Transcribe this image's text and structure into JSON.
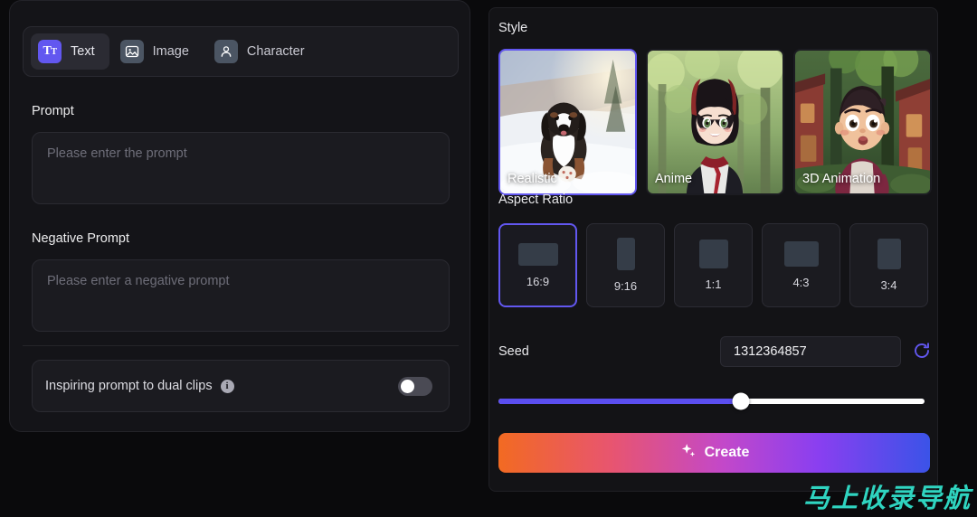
{
  "left_panel": {
    "tabs": [
      {
        "label": "Text",
        "icon": "text-format-icon",
        "active": true
      },
      {
        "label": "Image",
        "icon": "image-icon",
        "active": false
      },
      {
        "label": "Character",
        "icon": "person-icon",
        "active": false
      }
    ],
    "prompt": {
      "label": "Prompt",
      "value": "",
      "placeholder": "Please enter the prompt"
    },
    "negative_prompt": {
      "label": "Negative Prompt",
      "value": "",
      "placeholder": "Please enter a negative prompt"
    },
    "dual_clips": {
      "label": "Inspiring prompt to dual clips",
      "info_glyph": "i",
      "toggle_state": "off"
    }
  },
  "right_panel": {
    "style": {
      "title": "Style",
      "options": [
        {
          "label": "Realistic",
          "selected": true
        },
        {
          "label": "Anime",
          "selected": false
        },
        {
          "label": "3D Animation",
          "selected": false
        }
      ]
    },
    "aspect_ratio": {
      "title": "Aspect Ratio",
      "options": [
        {
          "label": "16:9",
          "selected": true
        },
        {
          "label": "9:16",
          "selected": false
        },
        {
          "label": "1:1",
          "selected": false
        },
        {
          "label": "4:3",
          "selected": false
        },
        {
          "label": "3:4",
          "selected": false
        }
      ]
    },
    "seed": {
      "label": "Seed",
      "value": "1312364857",
      "refresh_icon": "refresh-icon"
    },
    "slider": {
      "percent": 57
    },
    "create": {
      "label": "Create",
      "icon": "sparkle-icon"
    }
  },
  "watermark": {
    "text": "马上收录导航"
  },
  "colors": {
    "accent_purple": "#6257f0",
    "slider_fill": "#5b4ef0",
    "watermark_teal": "#2fd4c0",
    "panel_bg": "#141418",
    "page_bg": "#0a0a0c"
  }
}
